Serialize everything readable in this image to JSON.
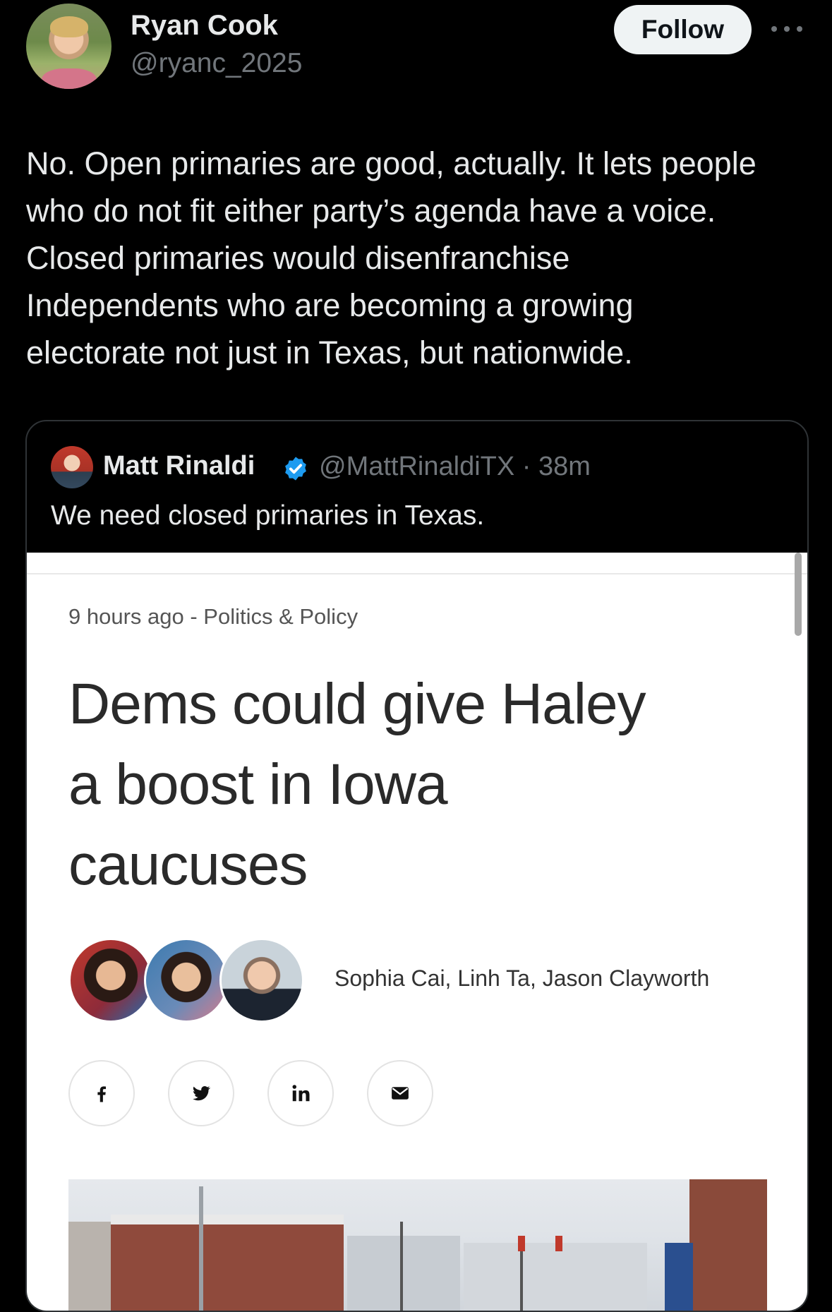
{
  "tweet": {
    "author_name": "Ryan Cook",
    "author_handle": "@ryanc_2025",
    "follow_label": "Follow",
    "text_lines": [
      "No. Open primaries are good, actually. It lets people",
      "who do not fit either party’s agenda have a voice.",
      "Closed primaries would disenfranchise",
      "Independents who are becoming a growing",
      "electorate not just in Texas, but nationwide."
    ]
  },
  "quote": {
    "author_name": "Matt Rinaldi",
    "author_handle_time": "@MattRinaldiTX · 38m",
    "text": "We need closed primaries in Texas.",
    "verified_color": "#1d9bf0"
  },
  "article": {
    "meta": "9 hours ago - Politics & Policy",
    "headline_lines": [
      "Dems could give Haley",
      "a boost in Iowa",
      "caucuses"
    ],
    "authors": "Sophia Cai, Linh Ta, Jason Clayworth",
    "share_icons": [
      "facebook-icon",
      "twitter-icon",
      "linkedin-icon",
      "email-icon"
    ]
  },
  "colors": {
    "background": "#000000",
    "text_primary": "#e7e9ea",
    "text_secondary": "#71767b",
    "follow_button_bg": "#eff3f4"
  }
}
